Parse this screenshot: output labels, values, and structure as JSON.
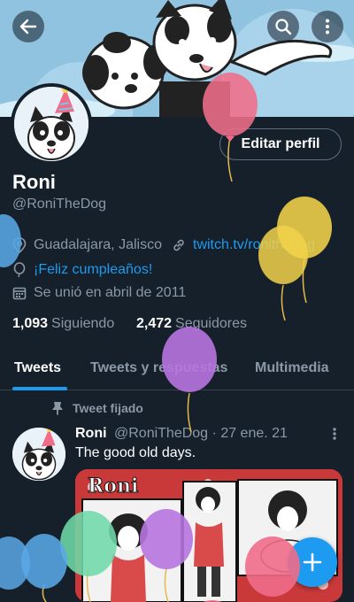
{
  "profile": {
    "name": "Roni",
    "handle": "@RoniTheDog",
    "edit_label": "Editar perfil",
    "location": "Guadalajara, Jalisco",
    "website": "twitch.tv/ronithedog",
    "birthday": "¡Feliz cumpleaños!",
    "joined": "Se unió en abril de 2011",
    "following_count": "1,093",
    "following_label": "Siguiendo",
    "followers_count": "2,472",
    "followers_label": "Seguidores"
  },
  "tabs": [
    {
      "label": "Tweets",
      "active": true
    },
    {
      "label": "Tweets y respuestas",
      "active": false
    },
    {
      "label": "Multimedia",
      "active": false
    }
  ],
  "pinned_label": "Tweet fijado",
  "tweet": {
    "author": "Roni",
    "handle": "@RoniTheDog",
    "separator": "·",
    "date": "27 ene. 21",
    "text": "The good old days.",
    "media_caption": "Roni"
  },
  "icons": {
    "back": "back-arrow-icon",
    "search": "search-icon",
    "more": "more-vertical-icon",
    "location": "location-pin-icon",
    "link": "link-icon",
    "birthday": "balloon-icon",
    "calendar": "calendar-icon",
    "pin": "pin-icon",
    "compose": "plus-icon"
  },
  "colors": {
    "background": "#15202b",
    "accent": "#1d9bf0",
    "muted_text": "#8b98a5"
  }
}
